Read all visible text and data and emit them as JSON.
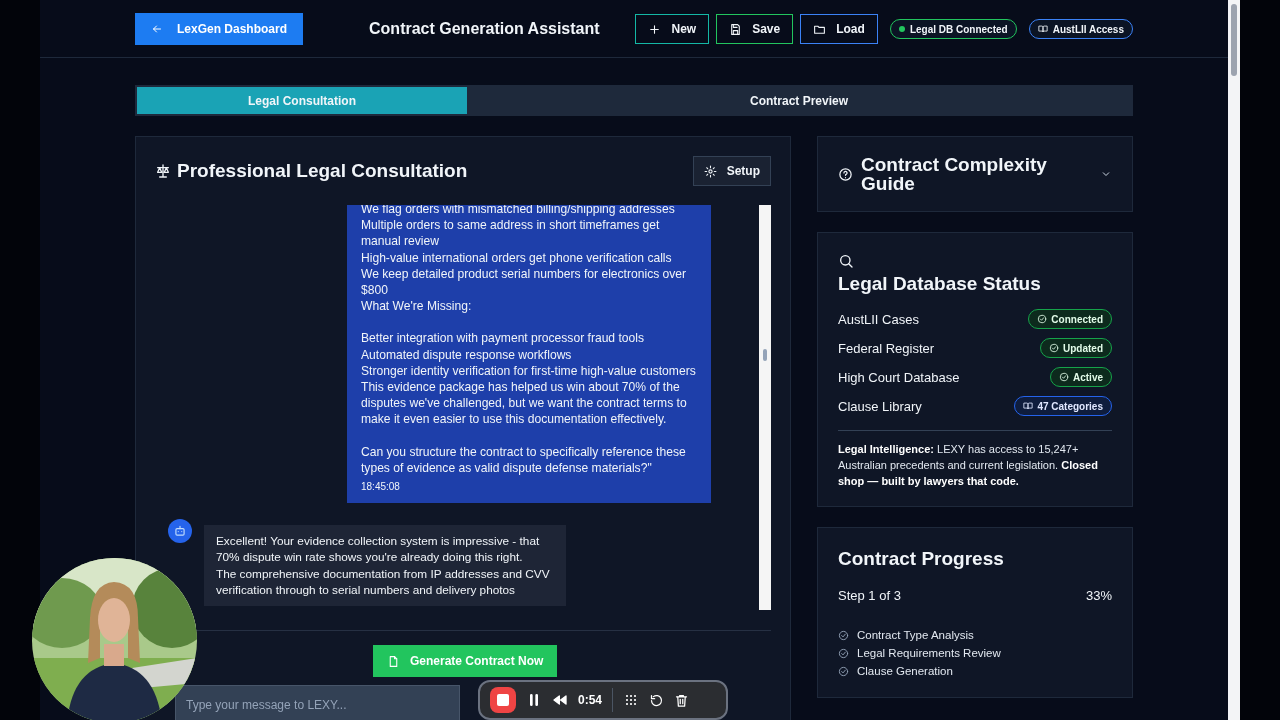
{
  "header": {
    "back_button": "LexGen Dashboard",
    "title": "Contract Generation Assistant",
    "actions": [
      {
        "label": "New",
        "kind": "new",
        "color": "#14b8a6"
      },
      {
        "label": "Save",
        "kind": "save",
        "color": "#22c55e"
      },
      {
        "label": "Load",
        "kind": "load",
        "color": "#3b82f6"
      }
    ],
    "badges": [
      {
        "label": "Legal DB Connected",
        "kind": "status",
        "color": "#22c55e"
      },
      {
        "label": "AustLII Access",
        "kind": "source",
        "color": "#3b82f6"
      }
    ]
  },
  "tabs": [
    {
      "label": "Legal Consultation",
      "selected": true
    },
    {
      "label": "Contract Preview",
      "selected": false
    }
  ],
  "consultation": {
    "title": "Professional Legal Consultation",
    "setup_button": "Setup",
    "messages": [
      {
        "kind": "user",
        "paragraphs": [
          [
            "We flag orders with mismatched billing/shipping addresses",
            "Multiple orders to same address in short timeframes get manual review",
            "High-value international orders get phone verification calls",
            "We keep detailed product serial numbers for electronics over $800",
            "What We're Missing:"
          ],
          [
            "Better integration with payment processor fraud tools",
            "Automated dispute response workflows",
            "Stronger identity verification for first-time high-value customers",
            "This evidence package has helped us win about 70% of the disputes we've challenged, but we want the contract terms to make it even easier to use this documentation effectively."
          ],
          [
            "Can you structure the contract to specifically reference these types of evidence as valid dispute defense materials?\""
          ]
        ],
        "time": "18:45:08"
      },
      {
        "kind": "assistant",
        "paragraphs": [
          [
            "Excellent! Your evidence collection system is impressive - that 70% dispute win rate shows you're already doing this right.",
            "The comprehensive documentation from IP addresses and CVV verification through to serial numbers and delivery photos"
          ]
        ]
      }
    ],
    "generate_button": "Generate Contract Now",
    "input": {
      "placeholder": "Type your message to LEXY..."
    }
  },
  "complexity_guide": {
    "title": "Contract Complexity Guide",
    "expanded": false
  },
  "database_status": {
    "title": "Legal Database Status",
    "sources": [
      {
        "name": "AustLII Cases",
        "status": "Connected",
        "kind": "check"
      },
      {
        "name": "Federal Register",
        "status": "Updated",
        "kind": "check"
      },
      {
        "name": "High Court Database",
        "status": "Active",
        "kind": "check"
      },
      {
        "name": "Clause Library",
        "status": "47 Categories",
        "kind": "book"
      }
    ],
    "note": "**Legal Intelligence:** LEXY has access to 15,247+ Australian precedents and current legislation. **Closed shop — built by lawyers that code.**"
  },
  "progress": {
    "title": "Contract Progress",
    "step": "Step 1 of 3",
    "percent": "33%",
    "steps": [
      "Contract Type Analysis",
      "Legal Requirements Review",
      "Clause Generation"
    ]
  },
  "recorder": {
    "time": "0:54"
  }
}
